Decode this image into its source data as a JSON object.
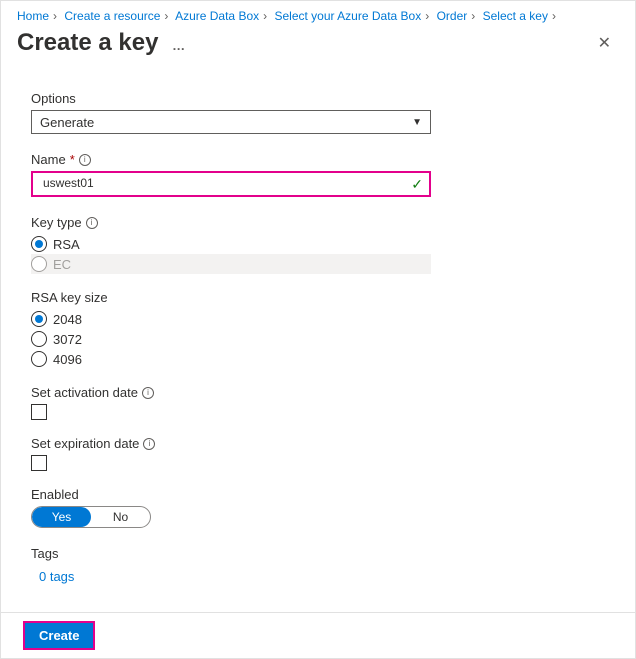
{
  "breadcrumb": [
    "Home",
    "Create a resource",
    "Azure Data Box",
    "Select your Azure Data Box",
    "Order",
    "Select a key"
  ],
  "header": {
    "title": "Create a key"
  },
  "options": {
    "label": "Options",
    "value": "Generate"
  },
  "name": {
    "label": "Name",
    "value": "uswest01"
  },
  "keyType": {
    "label": "Key type",
    "options": [
      {
        "label": "RSA",
        "checked": true,
        "disabled": false
      },
      {
        "label": "EC",
        "checked": false,
        "disabled": true
      }
    ]
  },
  "rsaSize": {
    "label": "RSA key size",
    "options": [
      {
        "label": "2048",
        "checked": true
      },
      {
        "label": "3072",
        "checked": false
      },
      {
        "label": "4096",
        "checked": false
      }
    ]
  },
  "activation": {
    "label": "Set activation date"
  },
  "expiration": {
    "label": "Set expiration date"
  },
  "enabled": {
    "label": "Enabled",
    "yes": "Yes",
    "no": "No"
  },
  "tags": {
    "label": "Tags",
    "link": "0 tags"
  },
  "footer": {
    "create": "Create"
  }
}
